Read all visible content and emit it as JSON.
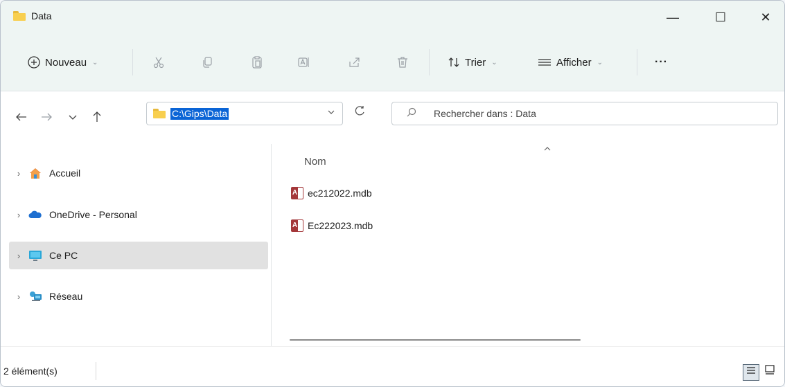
{
  "window": {
    "title": "Data",
    "controls": {
      "minimize": "—",
      "maximize": "☐",
      "close": "✕"
    }
  },
  "toolbar": {
    "new_label": "Nouveau",
    "sort_label": "Trier",
    "view_label": "Afficher",
    "more_label": "···",
    "icons": [
      "plus-circle-icon",
      "cut-icon",
      "copy-icon",
      "paste-icon",
      "rename-icon",
      "share-icon",
      "delete-icon",
      "sort-icon",
      "view-icon"
    ]
  },
  "nav": {
    "address": "C:\\Gips\\Data",
    "search_placeholder": "Rechercher dans : Data"
  },
  "sidebar": {
    "items": [
      {
        "label": "Accueil",
        "icon": "home-icon"
      },
      {
        "label": "OneDrive - Personal",
        "icon": "cloud-icon"
      },
      {
        "label": "Ce PC",
        "icon": "computer-icon",
        "selected": true
      },
      {
        "label": "Réseau",
        "icon": "network-icon"
      }
    ]
  },
  "content": {
    "column_name": "Nom",
    "files": [
      {
        "name": "ec212022.mdb",
        "icon": "access-db-icon"
      },
      {
        "name": "Ec222023.mdb",
        "icon": "access-db-icon"
      }
    ]
  },
  "status": {
    "count": "2 élément(s)"
  },
  "colors": {
    "accent": "#0a64d6",
    "toolbar_bg": "#eef5f3",
    "folder": "#f8cf4f",
    "access": "#a4373a",
    "selected_bg": "#e1e1e1"
  }
}
